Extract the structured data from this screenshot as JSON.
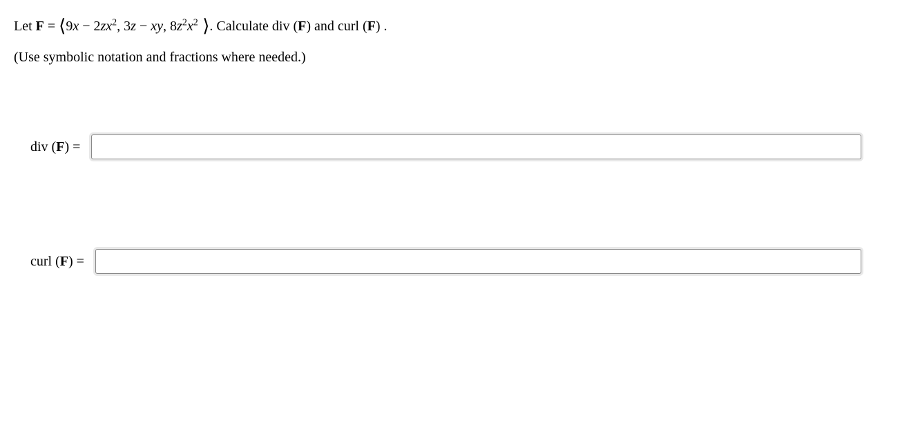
{
  "problem": {
    "prefix": "Let ",
    "var": "F",
    "equals": " = ",
    "bracket_open": "⟨",
    "component1_a": "9",
    "component1_b": "x",
    "component1_c": " − 2",
    "component1_d": "z",
    "component1_e": "x",
    "component1_sup": "2",
    "sep1": ", 3",
    "component2_a": "z",
    "component2_b": " − ",
    "component2_c": "x",
    "component2_d": "y",
    "sep2": ", 8",
    "component3_a": "z",
    "component3_sup1": "2",
    "component3_b": "x",
    "component3_sup2": "2",
    "bracket_close": " ⟩",
    "suffix1": ". Calculate div (",
    "suffix2": ") and curl (",
    "suffix3": ") ."
  },
  "instruction": "(Use symbolic notation and fractions where needed.)",
  "answers": {
    "div_label_prefix": "div (",
    "div_label_suffix": ") = ",
    "curl_label_prefix": "curl (",
    "curl_label_suffix": ") = ",
    "div_value": "",
    "curl_value": ""
  }
}
